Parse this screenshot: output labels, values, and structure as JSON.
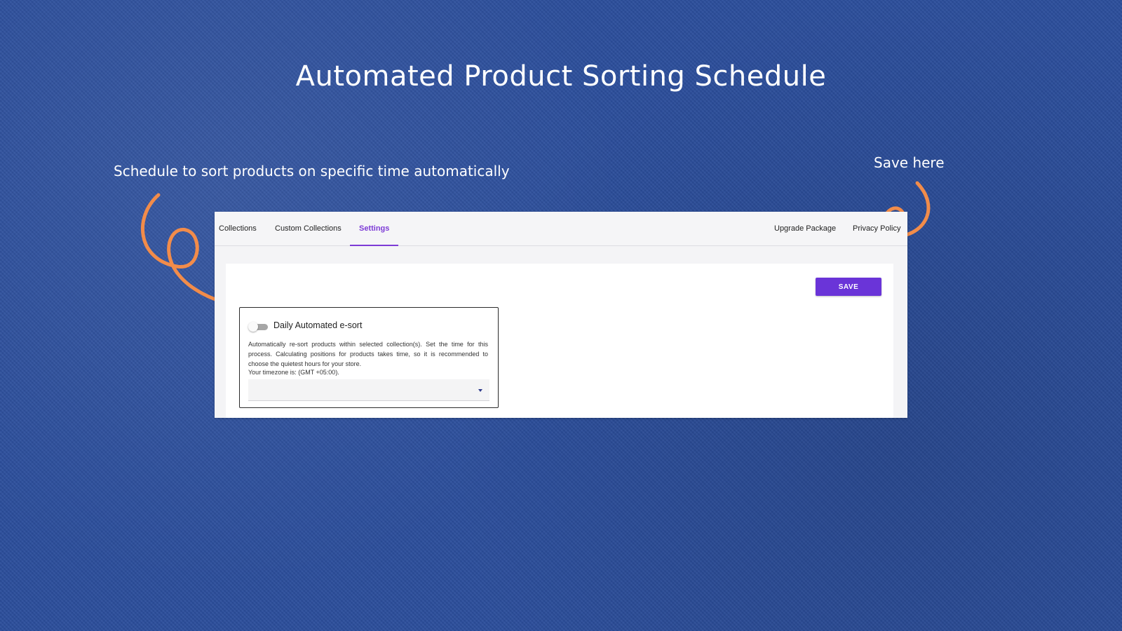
{
  "banner": {
    "title": "Automated Product Sorting Schedule",
    "callout_left": "Schedule to sort products on specific time automatically",
    "callout_right": "Save here",
    "arrow_color": "#f28c4a"
  },
  "tabs": {
    "collections": "Collections",
    "custom_collections": "Custom Collections",
    "settings": "Settings",
    "upgrade_package": "Upgrade Package",
    "privacy_policy": "Privacy Policy",
    "active": "Settings",
    "accent_color": "#7d3bd6"
  },
  "toolbar": {
    "save_label": "SAVE",
    "save_color": "#6a34d8"
  },
  "esort": {
    "title": "Daily Automated e-sort",
    "enabled": false,
    "description": "Automatically re-sort products within selected collection(s). Set the time for this process. Calculating positions for products takes time, so it is recommended to choose the quietest hours for your store.",
    "timezone_text": "Your timezone is: (GMT +05:00).",
    "time_select_value": ""
  },
  "icons": {
    "toggle": "toggle-switch-off-icon",
    "dropdown": "chevron-down-icon",
    "arrow_left": "curly-arrow-icon",
    "arrow_right": "curly-arrow-icon"
  }
}
